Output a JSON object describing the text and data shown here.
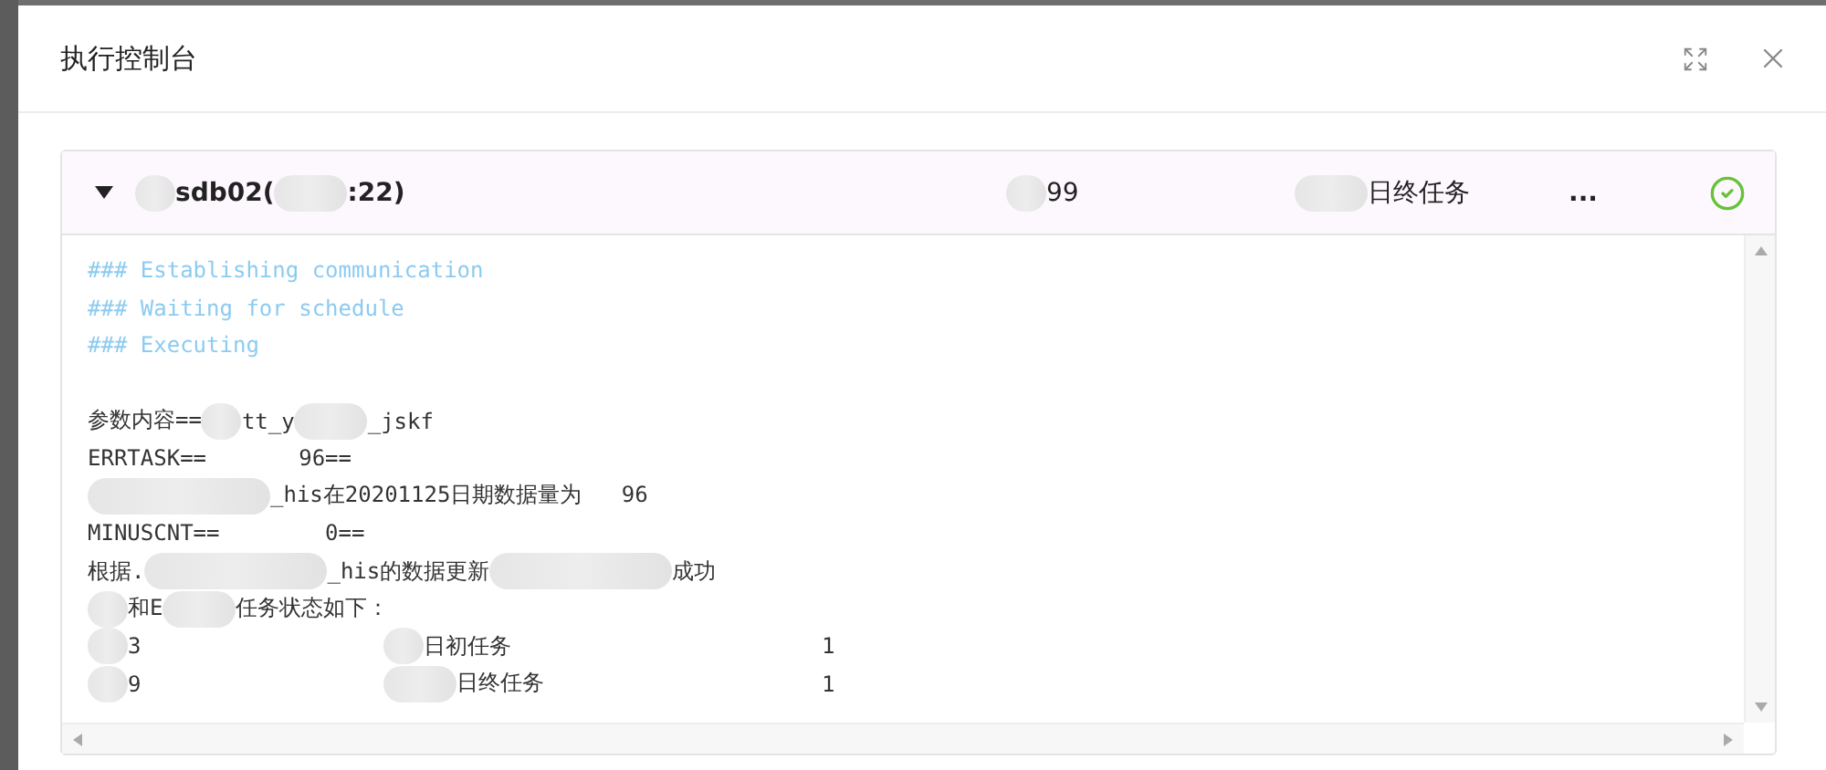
{
  "dialog": {
    "title": "执行控制台"
  },
  "task": {
    "expanded": true,
    "success": true,
    "host": [
      {
        "kind": "mask"
      },
      {
        "kind": "text",
        "text": "sdb02("
      },
      {
        "kind": "longmask"
      },
      {
        "kind": "text",
        "text": ":22)"
      }
    ],
    "code": [
      {
        "kind": "mask"
      },
      {
        "kind": "text",
        "text": "99"
      }
    ],
    "name": [
      {
        "kind": "longmask"
      },
      {
        "kind": "text",
        "text": "日终任务"
      }
    ],
    "more": "..."
  },
  "log": [
    {
      "kind": "info",
      "parts": [
        {
          "kind": "text",
          "text": "### Establishing communication"
        }
      ]
    },
    {
      "kind": "info",
      "parts": [
        {
          "kind": "text",
          "text": "### Waiting for schedule"
        }
      ]
    },
    {
      "kind": "info",
      "parts": [
        {
          "kind": "text",
          "text": "### Executing"
        }
      ]
    },
    {
      "kind": "blank"
    },
    {
      "kind": "plain",
      "parts": [
        {
          "kind": "text",
          "text": "参数内容=="
        },
        {
          "kind": "mask"
        },
        {
          "kind": "text",
          "text": "tt_y"
        },
        {
          "kind": "longmask"
        },
        {
          "kind": "text",
          "text": "_jskf"
        }
      ]
    },
    {
      "kind": "plain",
      "parts": [
        {
          "kind": "text",
          "text": "ERRTASK==       96=="
        }
      ]
    },
    {
      "kind": "plain",
      "parts": [
        {
          "kind": "widemask"
        },
        {
          "kind": "text",
          "text": "_his在20201125日期数据量为   96"
        }
      ]
    },
    {
      "kind": "plain",
      "parts": [
        {
          "kind": "text",
          "text": "MINUSCNT==        0=="
        }
      ]
    },
    {
      "kind": "plain",
      "parts": [
        {
          "kind": "text",
          "text": "根据."
        },
        {
          "kind": "widemask"
        },
        {
          "kind": "text",
          "text": "_his的数据更新"
        },
        {
          "kind": "widemask"
        },
        {
          "kind": "text",
          "text": "成功"
        }
      ]
    },
    {
      "kind": "plain",
      "parts": [
        {
          "kind": "mask"
        },
        {
          "kind": "text",
          "text": "和E"
        },
        {
          "kind": "longmask"
        },
        {
          "kind": "text",
          "text": "任务状态如下："
        }
      ]
    },
    {
      "kind": "row",
      "cells": [
        [
          {
            "kind": "mask"
          },
          {
            "kind": "text",
            "text": "3"
          }
        ],
        [
          {
            "kind": "mask"
          },
          {
            "kind": "text",
            "text": "日初任务"
          }
        ],
        [
          {
            "kind": "text",
            "text": "1"
          }
        ]
      ]
    },
    {
      "kind": "row",
      "cells": [
        [
          {
            "kind": "mask"
          },
          {
            "kind": "text",
            "text": "9"
          }
        ],
        [
          {
            "kind": "longmask"
          },
          {
            "kind": "text",
            "text": "日终任务"
          }
        ],
        [
          {
            "kind": "text",
            "text": "1"
          }
        ]
      ]
    }
  ]
}
